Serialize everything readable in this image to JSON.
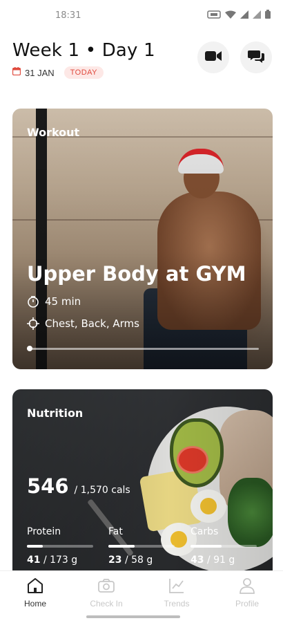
{
  "status_bar": {
    "time": "18:31"
  },
  "header": {
    "title": "Week 1 • Day 1",
    "date": "31 JAN",
    "today_badge": "TODAY",
    "video_button_icon": "video-camera-icon",
    "chat_button_icon": "chat-bubbles-icon"
  },
  "workout": {
    "label": "Workout",
    "title": "Upper Body at GYM",
    "duration": "45 min",
    "muscles": "Chest, Back, Arms",
    "progress": 0.0
  },
  "nutrition": {
    "label": "Nutrition",
    "calories": "546",
    "calories_goal": "/ 1,570 cals",
    "macros": [
      {
        "label": "Protein",
        "value": "41",
        "goal": "/ 173 g",
        "fraction": 0.24
      },
      {
        "label": "Fat",
        "value": "23",
        "goal": "/ 58 g",
        "fraction": 0.4
      },
      {
        "label": "Carbs",
        "value": "43",
        "goal": "/ 91 g",
        "fraction": 0.47
      }
    ]
  },
  "bottom_nav": {
    "items": [
      {
        "label": "Home",
        "icon": "home-icon",
        "active": true
      },
      {
        "label": "Check In",
        "icon": "camera-icon",
        "active": false
      },
      {
        "label": "Trends",
        "icon": "chart-line-icon",
        "active": false
      },
      {
        "label": "Profile",
        "icon": "user-icon",
        "active": false
      }
    ]
  },
  "colors": {
    "accent_red": "#e04a3d",
    "badge_bg": "#fde8e6",
    "nav_inactive": "#c8c8c8"
  }
}
